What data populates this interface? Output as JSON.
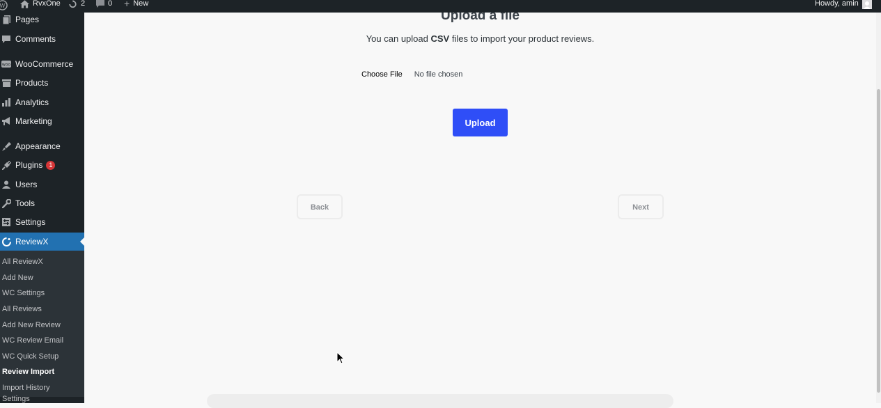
{
  "adminbar": {
    "site_name": "RvxOne",
    "updates_count": "2",
    "comments_count": "0",
    "new_label": "New",
    "greeting": "Howdy, amin"
  },
  "sidebar": {
    "items": [
      {
        "label": "Pages",
        "icon": "pages-icon"
      },
      {
        "label": "Comments",
        "icon": "comments-icon"
      },
      {
        "label": "WooCommerce",
        "icon": "woocommerce-icon"
      },
      {
        "label": "Products",
        "icon": "products-icon"
      },
      {
        "label": "Analytics",
        "icon": "analytics-icon"
      },
      {
        "label": "Marketing",
        "icon": "marketing-icon"
      },
      {
        "label": "Appearance",
        "icon": "appearance-icon"
      },
      {
        "label": "Plugins",
        "icon": "plugins-icon",
        "badge": "1"
      },
      {
        "label": "Users",
        "icon": "users-icon"
      },
      {
        "label": "Tools",
        "icon": "tools-icon"
      },
      {
        "label": "Settings",
        "icon": "settings-icon"
      },
      {
        "label": "ReviewX",
        "icon": "reviewx-icon",
        "current": true
      }
    ],
    "submenu": [
      "All ReviewX",
      "Add New",
      "WC Settings",
      "All Reviews",
      "Add New Review",
      "WC Review Email",
      "WC Quick Setup",
      "Review Import",
      "Import History",
      "Settings"
    ],
    "submenu_active": "Review Import"
  },
  "main": {
    "title": "Upload a file",
    "subtitle_before": "You can upload ",
    "subtitle_bold": "CSV",
    "subtitle_after": " files to import your product reviews.",
    "choose_file_label": "Choose File",
    "no_file_text": "No file chosen",
    "upload_label": "Upload",
    "back_label": "Back",
    "next_label": "Next"
  },
  "colors": {
    "admin_dark": "#1d2327",
    "accent_blue": "#2271b1",
    "upload_button": "#2f4ef7",
    "badge_red": "#d63638"
  }
}
